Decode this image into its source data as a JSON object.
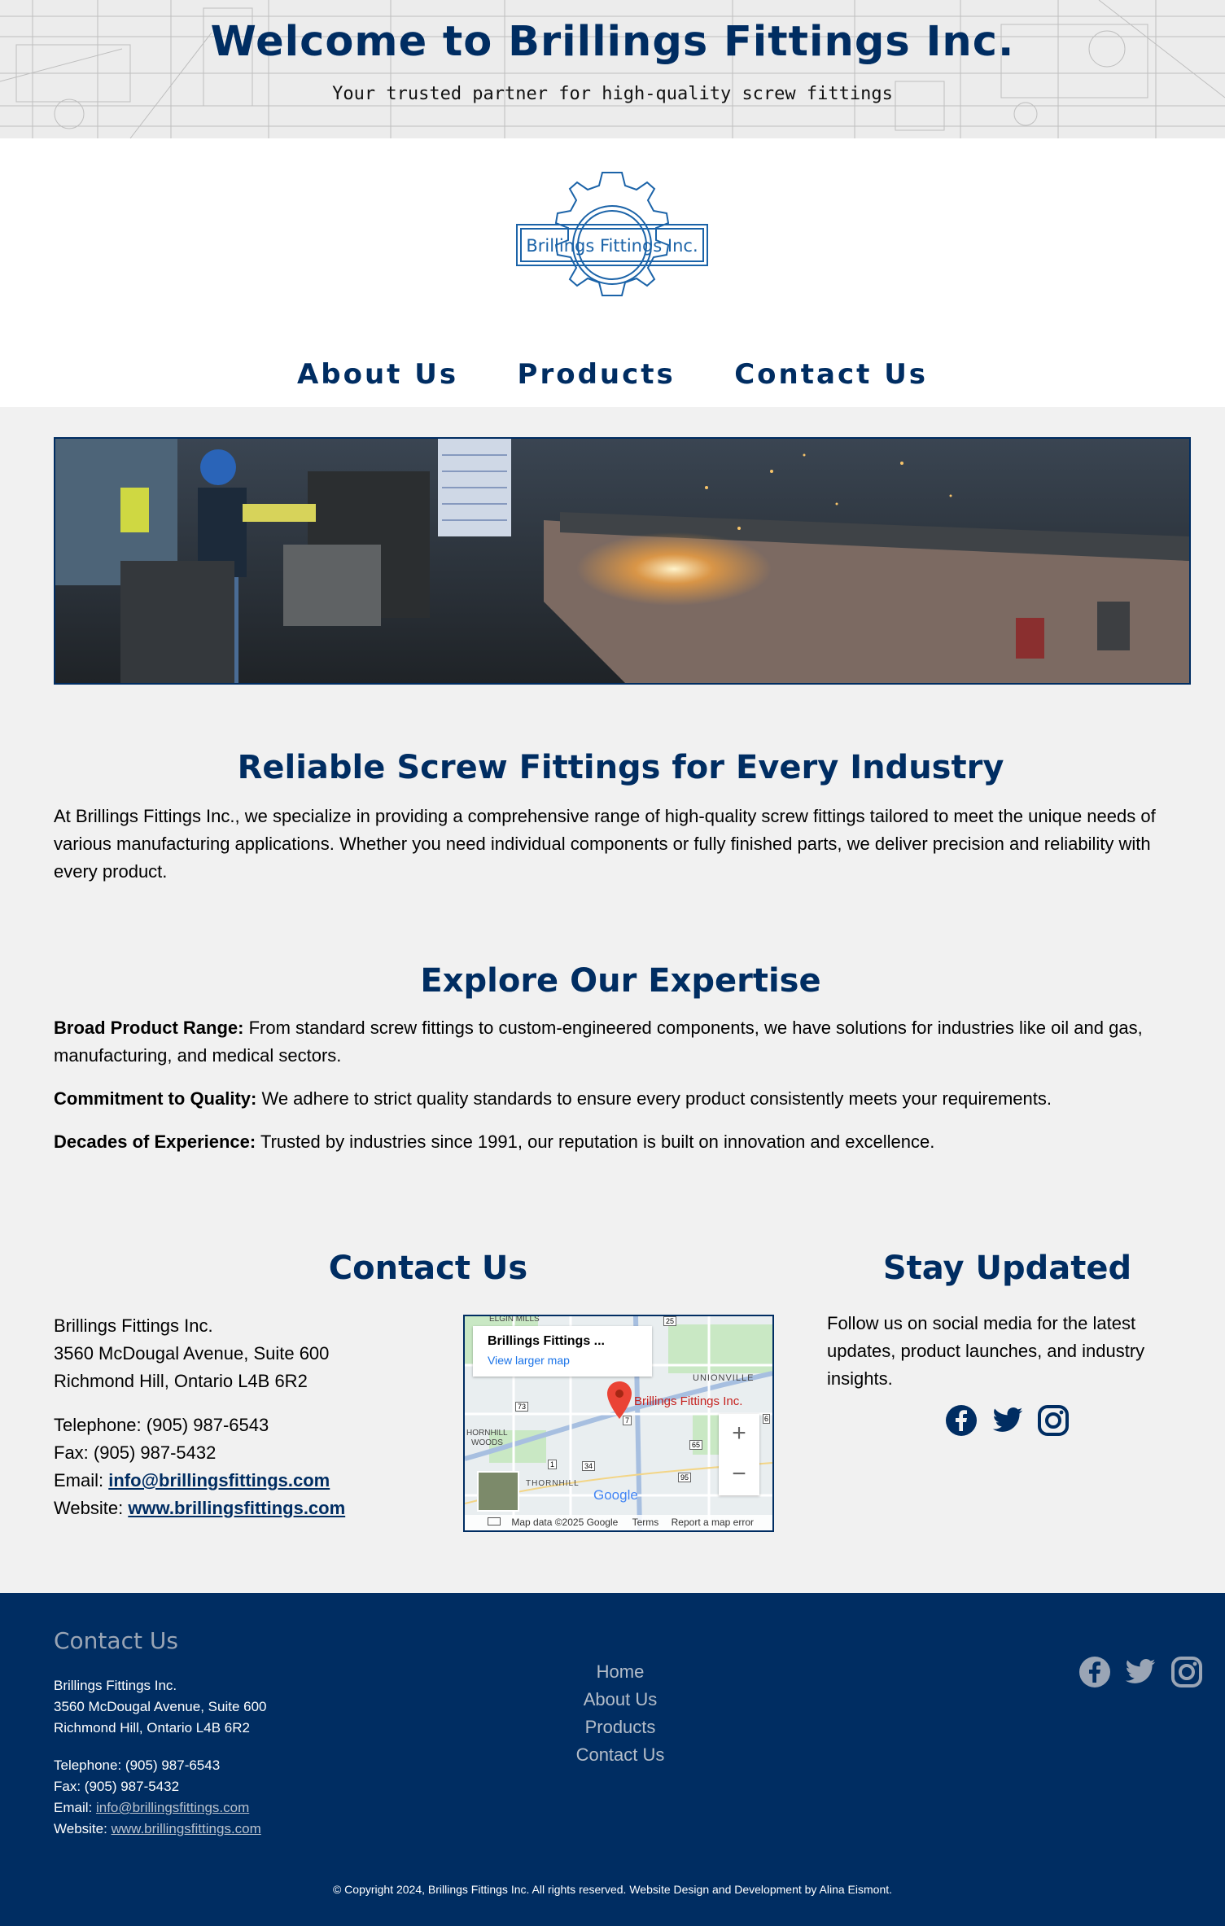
{
  "header": {
    "title": "Welcome to Brillings Fittings Inc.",
    "tagline": "Your trusted partner for high-quality screw fittings"
  },
  "logo": {
    "text": "Brillings Fittings Inc."
  },
  "nav": {
    "items": [
      {
        "label": "About Us"
      },
      {
        "label": "Products"
      },
      {
        "label": "Contact Us"
      }
    ]
  },
  "reliable": {
    "title": "Reliable Screw Fittings for Every Industry",
    "body": "At Brillings Fittings Inc., we specialize in providing a comprehensive range of high-quality screw fittings tailored to meet the unique needs of various manufacturing applications. Whether you need individual components or fully finished parts, we deliver precision and reliability with every product."
  },
  "expertise": {
    "title": "Explore Our Expertise",
    "items": [
      {
        "label": "Broad Product Range:",
        "text": " From standard screw fittings to custom-engineered components, we have solutions for industries like oil and gas, manufacturing, and medical sectors."
      },
      {
        "label": "Commitment to Quality:",
        "text": " We adhere to strict quality standards to ensure every product consistently meets your requirements."
      },
      {
        "label": "Decades of Experience:",
        "text": " Trusted by industries since 1991, our reputation is built on innovation and excellence."
      }
    ]
  },
  "contact": {
    "title": "Contact Us",
    "company": "Brillings Fittings Inc.",
    "street": "3560 McDougal Avenue, Suite 600",
    "city": "Richmond Hill, Ontario L4B 6R2",
    "telephone_label": "Telephone:",
    "telephone": "(905) 987-6543",
    "fax_label": "Fax:",
    "fax": "(905) 987-5432",
    "email_label": "Email:",
    "email": "info@brillingsfittings.com",
    "website_label": "Website:",
    "website": "www.brillingsfittings.com"
  },
  "map": {
    "place_title": "Brillings Fittings ...",
    "view_larger": "View larger map",
    "pin_label": "Brillings Fittings Inc.",
    "labels": [
      "ELGIN MILLS",
      "UNIONVILLE",
      "HORNHILL",
      "WOODS",
      "THORNHILL"
    ],
    "road_numbers": [
      "25",
      "73",
      "7",
      "65",
      "1",
      "34",
      "95",
      "6"
    ],
    "zoom_in": "+",
    "zoom_out": "−",
    "google": "Google",
    "map_data": "Map data ©2025 Google",
    "terms": "Terms",
    "report": "Report a map error"
  },
  "stay": {
    "title": "Stay Updated",
    "body": "Follow us on social media for the latest updates, product launches, and industry insights."
  },
  "social_icons": [
    "facebook-icon",
    "twitter-icon",
    "instagram-icon"
  ],
  "footer": {
    "title": "Contact Us",
    "company": "Brillings Fittings Inc.",
    "street": "3560 McDougal Avenue, Suite 600",
    "city": "Richmond Hill, Ontario L4B 6R2",
    "telephone_label": "Telephone:",
    "telephone": "(905) 987-6543",
    "fax_label": "Fax:",
    "fax": "(905) 987-5432",
    "email_label": "Email:",
    "email": "info@brillingsfittings.com",
    "website_label": "Website:",
    "website": "www.brillingsfittings.com",
    "nav": [
      "Home",
      "About Us",
      "Products",
      "Contact Us"
    ],
    "copyright": "© Copyright 2024, Brillings Fittings Inc. All rights reserved. Website Design and Development by Alina Eismont."
  },
  "colors": {
    "navy": "#002d62",
    "background": "#f1f1f1",
    "footer_text_muted": "#b4bdc9"
  }
}
